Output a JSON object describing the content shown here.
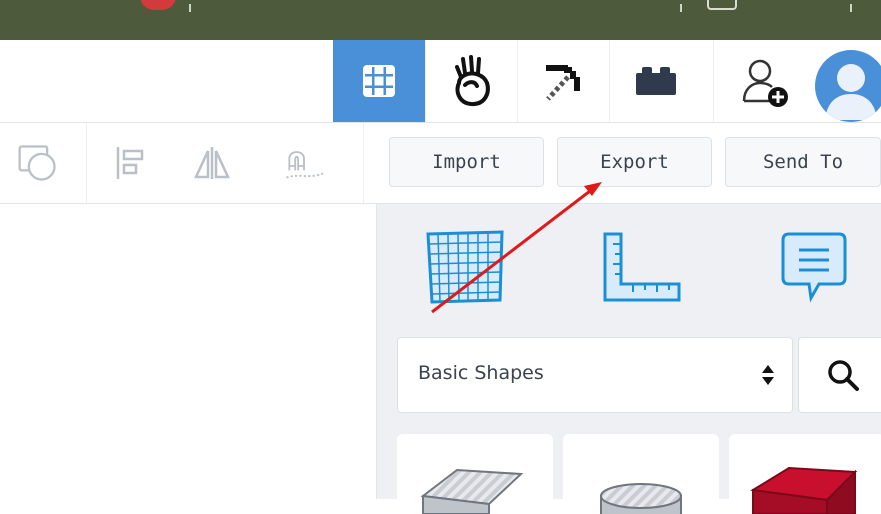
{
  "header": {
    "icons": [
      "grid-view-icon",
      "tinkercad-hand-icon",
      "pickaxe-icon",
      "brick-icon",
      "add-user-icon"
    ],
    "accent": "#4a90d9"
  },
  "toolbar": {
    "tools": [
      "group-icon",
      "align-icon",
      "mirror-icon",
      "cruise-icon"
    ],
    "import_label": "Import",
    "export_label": "Export",
    "send_to_label": "Send To"
  },
  "panel": {
    "views": [
      "workplane-icon",
      "ruler-icon",
      "notes-icon"
    ],
    "shape_category": "Basic Shapes",
    "shapes": [
      "box-shape",
      "cylinder-shape",
      "red-box-shape"
    ]
  }
}
